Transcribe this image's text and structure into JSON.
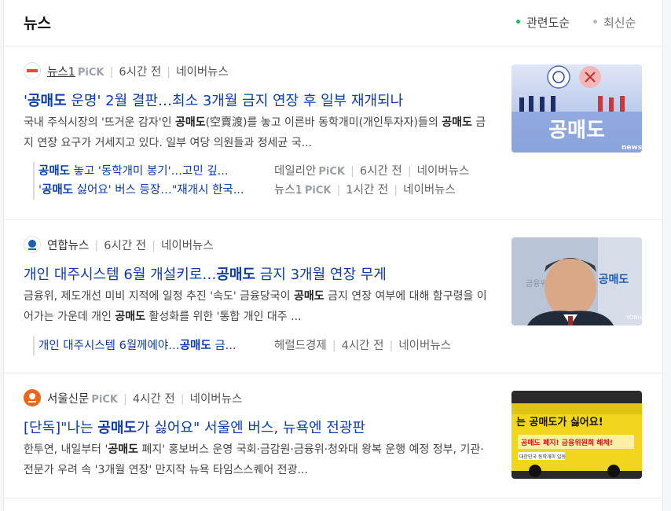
{
  "header": {
    "title": "뉴스",
    "sort_relevance": "관련도순",
    "sort_latest": "최신순"
  },
  "articles": [
    {
      "press": "뉴스1",
      "pick": "PiCK",
      "time": "6시간 전",
      "portal": "네이버뉴스",
      "title_pre": "'",
      "title_kw": "공매도",
      "title_post": " 운명' 2월 결판…최소 3개월 금지 연장 후 일부 재개되나",
      "desc_a": "국내 주식시장의 '뜨거운 감자'인 ",
      "desc_kw1": "공매도",
      "desc_b": "(空賣渡)를 놓고 이른바 동학개미(개인투자자)들의 ",
      "desc_kw2": "공매도",
      "desc_c": " 금지 연장 요구가 거세지고 있다. 일부 여당 의원들과 정세균 국...",
      "thumb_text": "공매도",
      "thumb_watermark": "news1",
      "related": [
        {
          "kw": "공매도",
          "text": " 놓고 '동학개미 봉기'…고민 깊...",
          "press": "데일리안",
          "pick": "PiCK",
          "time": "6시간 전",
          "portal": "네이버뉴스"
        },
        {
          "kw_pre": "'",
          "kw": "공매도",
          "text": " 싫어요' 버스 등장…\"재개시 한국...",
          "press": "뉴스1",
          "pick": "PiCK",
          "time": "1시간 전",
          "portal": "네이버뉴스"
        }
      ]
    },
    {
      "press": "연합뉴스",
      "time": "6시간 전",
      "portal": "네이버뉴스",
      "title_pre": "개인 대주시스템 6월 개설키로…",
      "title_kw": "공매도",
      "title_post": " 금지 3개월 연장 무게",
      "desc_a": "금융위, 제도개선 미비 지적에 일정 추진 '속도' 금융당국이 ",
      "desc_kw1": "공매도",
      "desc_b": " 금지 연장 여부에 대해 함구령을 이어가는 가운데 개인 ",
      "desc_kw2": "공매도",
      "desc_c": " 활성화를 위한 '통합 개인 대주 ...",
      "thumb_text": "공매도",
      "thumb_bg_text": "금융위",
      "thumb_watermark": "YONHAP",
      "related": [
        {
          "text_pre": "개인 대주시스템 6월께에야…",
          "kw": "공매도",
          "text": " 금...",
          "press": "헤럴드경제",
          "time": "4시간 전",
          "portal": "네이버뉴스"
        }
      ]
    },
    {
      "press": "서울신문",
      "pick": "PiCK",
      "time": "4시간 전",
      "portal": "네이버뉴스",
      "title_pre": "[단독]\"나는 ",
      "title_kw": "공매도",
      "title_post": "가 싫어요\" 서울엔 버스, 뉴욕엔 전광판",
      "desc_a": "한투연, 내일부터 '",
      "desc_kw1": "공매도",
      "desc_b": " 폐지' 홍보버스 운영 국회·금감원·금융위·청와대 왕복 운행 예정 정부, 기관·전문가 우려 속 '3개월 연장' 만지작 뉴욕 타임스스퀘어 전광...",
      "desc_kw2": "",
      "desc_c": "",
      "thumb_text": "는 공매도가 싫어요!",
      "thumb_text2": "공매도 폐지! 금융위원회 해체!",
      "thumb_text3": "대한민국 동학개미 일동"
    }
  ]
}
